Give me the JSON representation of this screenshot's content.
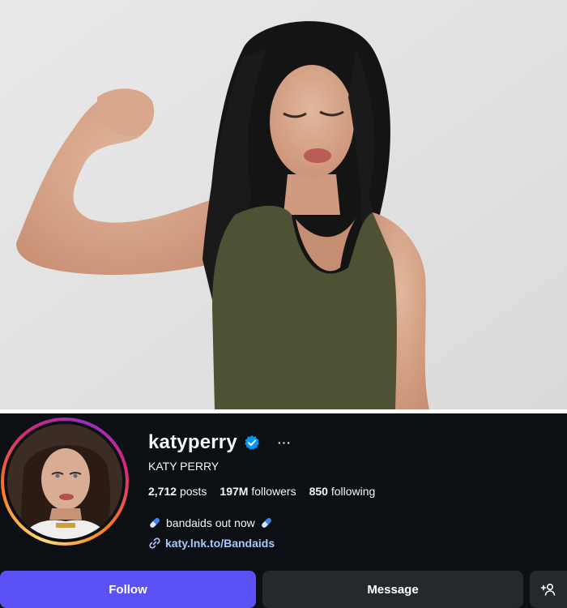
{
  "profile": {
    "username": "katyperry",
    "verified": true,
    "more_label": "···",
    "full_name": "KATY PERRY",
    "stats": {
      "posts_count": "2,712",
      "posts_label": "posts",
      "followers_count": "197M",
      "followers_label": "followers",
      "following_count": "850",
      "following_label": "following"
    },
    "bio": "bandaids out now",
    "link": "katy.lnk.to/Bandaids"
  },
  "actions": {
    "follow_label": "Follow",
    "message_label": "Message"
  },
  "colors": {
    "panel_bg": "#0c1014",
    "follow_button": "#5b51f5",
    "secondary_button": "#25292e",
    "link": "#a8c7fa",
    "verified_badge": "#0095f6"
  },
  "icons": {
    "verified": "verified-badge-icon",
    "pill": "pill-emoji-icon",
    "link": "link-icon",
    "add_person": "add-person-icon"
  }
}
